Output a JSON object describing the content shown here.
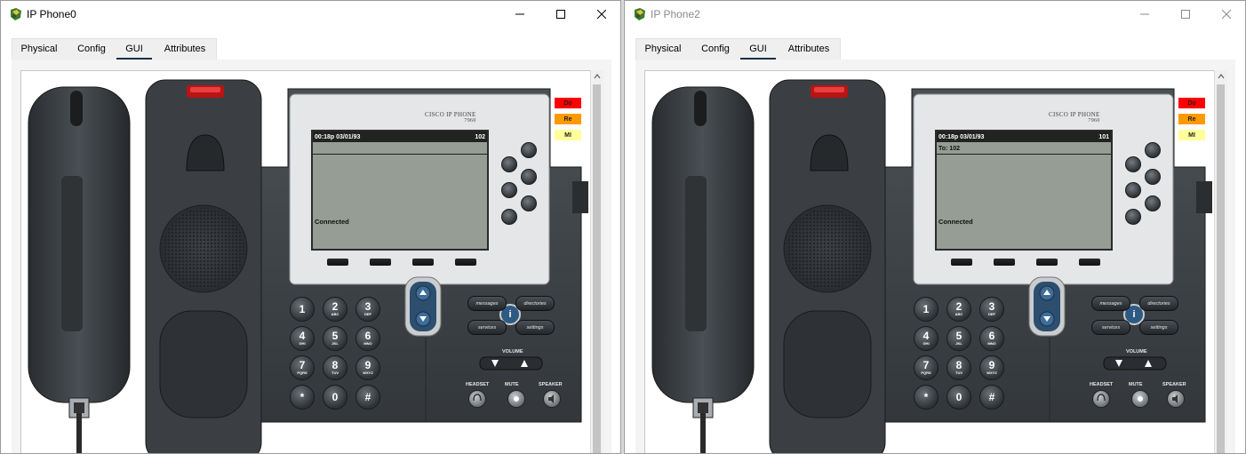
{
  "windows": [
    {
      "title": "IP Phone0",
      "active": true,
      "tabs": [
        "Physical",
        "Config",
        "GUI",
        "Attributes"
      ],
      "active_tab": "GUI",
      "phone": {
        "brand": "CISCO IP PHONE",
        "model": "7960",
        "clock": "00:18p 03/01/93",
        "extension": "102",
        "line2": "",
        "status": "Connected",
        "side_buttons": [
          "Do",
          "Re",
          "MI"
        ],
        "keys": [
          {
            "d": "1",
            "l": ""
          },
          {
            "d": "2",
            "l": "ABC"
          },
          {
            "d": "3",
            "l": "DEF"
          },
          {
            "d": "4",
            "l": "GHI"
          },
          {
            "d": "5",
            "l": "JKL"
          },
          {
            "d": "6",
            "l": "MNO"
          },
          {
            "d": "7",
            "l": "PQRS"
          },
          {
            "d": "8",
            "l": "TUV"
          },
          {
            "d": "9",
            "l": "WXYZ"
          },
          {
            "d": "*",
            "l": ""
          },
          {
            "d": "0",
            "l": ""
          },
          {
            "d": "#",
            "l": ""
          }
        ],
        "messages": "messages",
        "directories": "directories",
        "services": "services",
        "settings": "settings",
        "info": "i",
        "volume": "VOLUME",
        "headset": "HEADSET",
        "mute": "MUTE",
        "speaker": "SPEAKER"
      }
    },
    {
      "title": "IP Phone2",
      "active": false,
      "tabs": [
        "Physical",
        "Config",
        "GUI",
        "Attributes"
      ],
      "active_tab": "GUI",
      "phone": {
        "brand": "CISCO IP PHONE",
        "model": "7960",
        "clock": "00:18p 03/01/93",
        "extension": "101",
        "line2": "To: 102",
        "status": "Connected",
        "side_buttons": [
          "Do",
          "Re",
          "MI"
        ],
        "keys": [
          {
            "d": "1",
            "l": ""
          },
          {
            "d": "2",
            "l": "ABC"
          },
          {
            "d": "3",
            "l": "DEF"
          },
          {
            "d": "4",
            "l": "GHI"
          },
          {
            "d": "5",
            "l": "JKL"
          },
          {
            "d": "6",
            "l": "MNO"
          },
          {
            "d": "7",
            "l": "PQRS"
          },
          {
            "d": "8",
            "l": "TUV"
          },
          {
            "d": "9",
            "l": "WXYZ"
          },
          {
            "d": "*",
            "l": ""
          },
          {
            "d": "0",
            "l": ""
          },
          {
            "d": "#",
            "l": ""
          }
        ],
        "messages": "messages",
        "directories": "directories",
        "services": "services",
        "settings": "settings",
        "info": "i",
        "volume": "VOLUME",
        "headset": "HEADSET",
        "mute": "MUTE",
        "speaker": "SPEAKER"
      }
    }
  ],
  "colors": {
    "do": "#ff0000",
    "re": "#ff9900",
    "mi": "#ffff99",
    "tab_underline": "#1b2f48",
    "screen": "#959d94"
  },
  "icons": {
    "app": "packet-tracer-phone-icon",
    "minimize": "minimize-icon",
    "maximize": "maximize-icon",
    "close": "close-icon"
  }
}
